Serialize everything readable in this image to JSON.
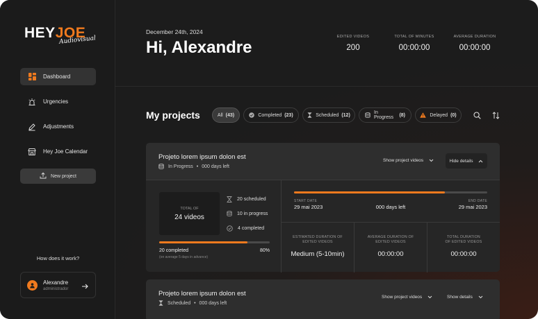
{
  "brand": {
    "hey": "HEY",
    "joe": "JOE",
    "tagline": "Audiovisual"
  },
  "sidebar": {
    "items": [
      {
        "label": "Dashboard"
      },
      {
        "label": "Urgencies"
      },
      {
        "label": "Adjustments"
      },
      {
        "label": "Hey Joe Calendar"
      }
    ],
    "new_project": "New project",
    "how_it_works": "How does it work?",
    "user": {
      "name": "Alexandre",
      "role": "administrador"
    }
  },
  "header": {
    "date": "December 24th, 2024",
    "greeting": "Hi, Alexandre",
    "stats": [
      {
        "label": "EDITED VIDEOS",
        "value": "200"
      },
      {
        "label": "TOTAL OF MINUTES",
        "value": "00:00:00"
      },
      {
        "label": "AVERAGE DURATION",
        "value": "00:00:00"
      }
    ]
  },
  "projects": {
    "title": "My projects",
    "filters": [
      {
        "label": "All",
        "count": "(43)"
      },
      {
        "label": "Completed",
        "count": "(23)"
      },
      {
        "label": "Scheduled",
        "count": "(12)"
      },
      {
        "label": "In Progress",
        "count": "(8)"
      },
      {
        "label": "Delayed",
        "count": "(0)"
      }
    ],
    "cards": [
      {
        "title": "Projeto lorem ipsum dolon est",
        "status": "In Progress",
        "days_left": "000 days left",
        "show_videos": "Show project videos",
        "details_btn": "Hide details",
        "total_label": "TOTAL OF",
        "total_value": "24 videos",
        "scheduled": "20 scheduled",
        "in_progress": "10 in progress",
        "completed_count": "4 completed",
        "completed_label": "20 completed",
        "completed_pct": "80%",
        "completed_fraction": 0.8,
        "avg_note": "(on average 5 days in advance)",
        "timeline_fraction": 0.78,
        "start_label": "START DATE",
        "start_value": "29 mai 2023",
        "days_mid": "000 days left",
        "end_label": "END DATE",
        "end_value": "29 mai 2023",
        "metrics": [
          {
            "label_1": "ESTIMATED DURATION OF",
            "label_2": "EDITED VIDEOS",
            "value": "Medium (5-10min)"
          },
          {
            "label_1": "AVERAGE DURATION OF",
            "label_2": "EDITED VIDEOS",
            "value": "00:00:00"
          },
          {
            "label_1": "TOTAL DURATION",
            "label_2": "OF EDITED VIDEOS",
            "value": "00:00:00"
          }
        ]
      },
      {
        "title": "Projeto lorem ipsum dolon est",
        "status": "Scheduled",
        "days_left": "000 days left",
        "show_videos": "Show project videos",
        "details_btn": "Show details"
      }
    ]
  },
  "colors": {
    "accent": "#f07a1e",
    "background": "#1c1c1c",
    "card": "#2e2e2e"
  }
}
